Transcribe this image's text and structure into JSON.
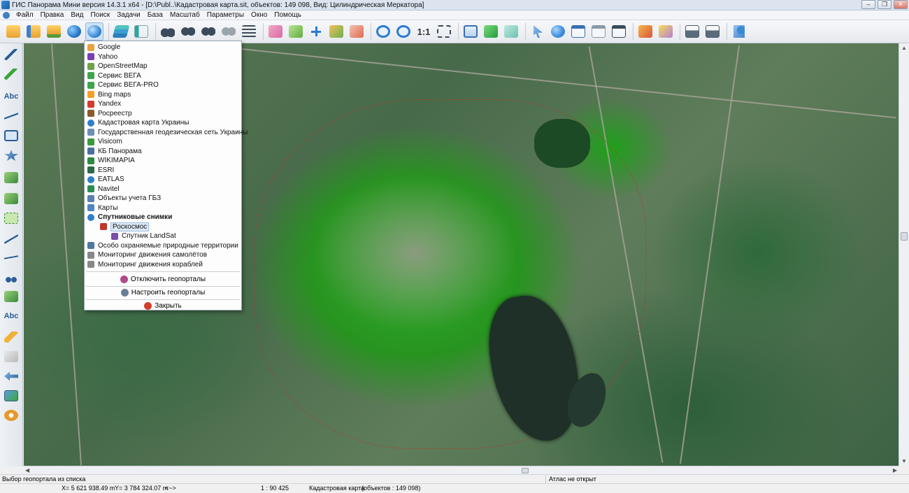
{
  "window": {
    "title": "ГИС Панорама Мини версия 14.3.1 x64 - [D:\\Publ..\\Кадастровая карта.sit, объектов: 149 098, Вид: Цилиндрическая Меркатора]",
    "controls": [
      "–",
      "❐",
      "✕"
    ]
  },
  "menubar": {
    "items": [
      "Файл",
      "Правка",
      "Вид",
      "Поиск",
      "Задачи",
      "База",
      "Масштаб",
      "Параметры",
      "Окно",
      "Помощь"
    ]
  },
  "toolbar": {
    "scale_label": "1:1",
    "colors": {
      "accent": "#2c7bd3",
      "green": "#3aa53a",
      "orange": "#f0a032"
    }
  },
  "left_tools": {
    "abc_label_top": "Abc",
    "abc_label_bottom": "Abc"
  },
  "geoportal_menu": {
    "items": [
      {
        "label": "Google",
        "icon": "google-icon",
        "color": "#e8a33a"
      },
      {
        "label": "Yahoo",
        "icon": "yahoo-icon",
        "color": "#7a3fb0"
      },
      {
        "label": "OpenStreetMap",
        "icon": "osm-icon",
        "color": "#6fa34b"
      },
      {
        "label": "Сервис ВЕГА",
        "icon": "leaf-icon",
        "color": "#3fa44a"
      },
      {
        "label": "Сервис ВЕГА-PRO",
        "icon": "leaf-icon",
        "color": "#3fa44a"
      },
      {
        "label": "Bing maps",
        "icon": "bing-icon",
        "color": "#f2a02c"
      },
      {
        "label": "Yandex",
        "icon": "yandex-icon",
        "color": "#d33b2c"
      },
      {
        "label": "Росреестр",
        "icon": "rosreestr-icon",
        "color": "#8a5a2b"
      },
      {
        "label": "Кадастровая карта Украины",
        "icon": "globe-icon",
        "color": "#2f7fc8"
      },
      {
        "label": "Государственная геодезическая сеть Украины",
        "icon": "grid-icon",
        "color": "#6c8fb3"
      },
      {
        "label": "Visicom",
        "icon": "visicom-icon",
        "color": "#3a9a3a"
      },
      {
        "label": "КБ Панорама",
        "icon": "panorama-icon",
        "color": "#4a6fa0"
      },
      {
        "label": "WIKIMAPIA",
        "icon": "wikimapia-icon",
        "color": "#2d8a3e"
      },
      {
        "label": "ESRI",
        "icon": "esri-icon",
        "color": "#2e6a48"
      },
      {
        "label": "EATLAS",
        "icon": "globe-icon",
        "color": "#2f7fc8"
      },
      {
        "label": "Navitel",
        "icon": "navitel-icon",
        "color": "#2e8a55"
      },
      {
        "label": "Объекты учета ГБЗ",
        "icon": "gbz-icon",
        "color": "#5a7fb0"
      },
      {
        "label": "Карты",
        "icon": "map-icon",
        "color": "#4f86c0"
      },
      {
        "label": "Спутниковые снимки",
        "icon": "satellite-globe-icon",
        "color": "#2f7fc8",
        "bold": true
      },
      {
        "label": "Роскосмос",
        "icon": "roscosmos-icon",
        "color": "#c0392b",
        "selected": true
      },
      {
        "label": "Спутник LandSat",
        "icon": "check-icon",
        "color": "#7b4fa6"
      },
      {
        "label": "Особо охраняемые природные территории",
        "icon": "nature-icon",
        "color": "#4d7a9e"
      },
      {
        "label": "Мониторинг движения самолётов",
        "icon": "plane-icon",
        "color": "#888888"
      },
      {
        "label": "Мониторинг движения кораблей",
        "icon": "ship-icon",
        "color": "#888888"
      }
    ],
    "actions": {
      "disable": "Отключить геопорталы",
      "configure": "Настроить геопорталы",
      "close": "Закрыть"
    }
  },
  "status": {
    "hint": "Выбор геопортала из списка",
    "atlas": "Атлас не открыт",
    "x": "X= 5 621 938.49 m",
    "y": "Y= 3 784 324.07 m",
    "arrows": "<~>",
    "scale": "1 : 90 425",
    "layer": "Кадастровая карта",
    "objects": "(объектов : 149 098)"
  }
}
